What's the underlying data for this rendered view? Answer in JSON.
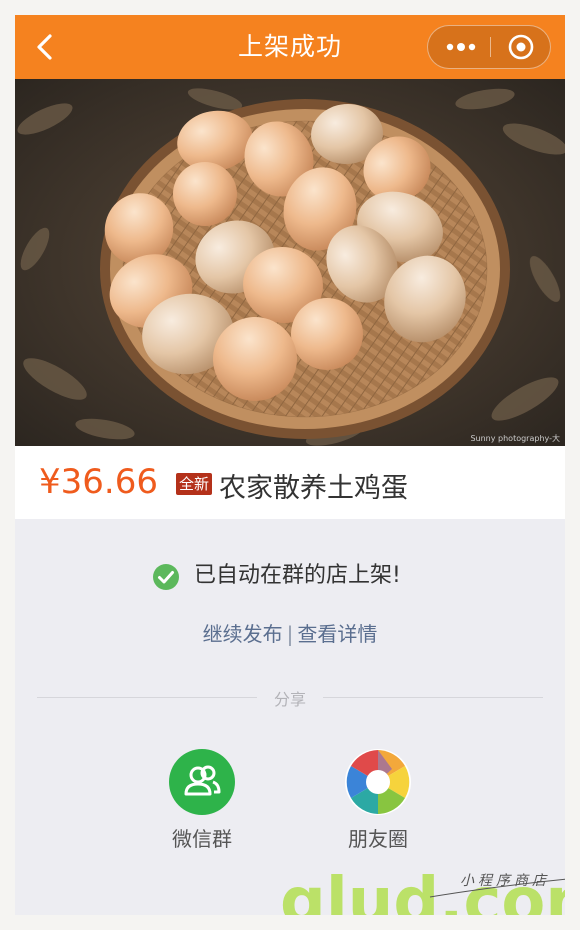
{
  "navbar": {
    "title": "上架成功",
    "background_color": "#f5821f",
    "back_icon": "chevron-left-icon",
    "more_icon": "more-dots-icon",
    "close_icon": "target-close-icon"
  },
  "product": {
    "image_alt": "农家散养土鸡蛋",
    "price": "¥36.66",
    "condition_badge": "全新",
    "name": "农家散养土鸡蛋",
    "photo_credit": "Sunny photography-大"
  },
  "status": {
    "icon": "check-circle-icon",
    "message": "已自动在群的店上架!"
  },
  "actions": {
    "continue_label": "继续发布",
    "separator": "|",
    "details_label": "查看详情"
  },
  "share": {
    "label": "分享",
    "targets": [
      {
        "label": "微信群",
        "icon": "wechat-group-icon",
        "color": "#2eb34a"
      },
      {
        "label": "朋友圈",
        "icon": "moments-aperture-icon"
      }
    ]
  },
  "watermark": {
    "logo": "glud.com",
    "tagline": "小程序商店"
  },
  "colors": {
    "accent": "#f5821f",
    "price": "#ef5b1d",
    "badge": "#b4311a",
    "link": "#5a6e8f",
    "success": "#5cb85c"
  }
}
